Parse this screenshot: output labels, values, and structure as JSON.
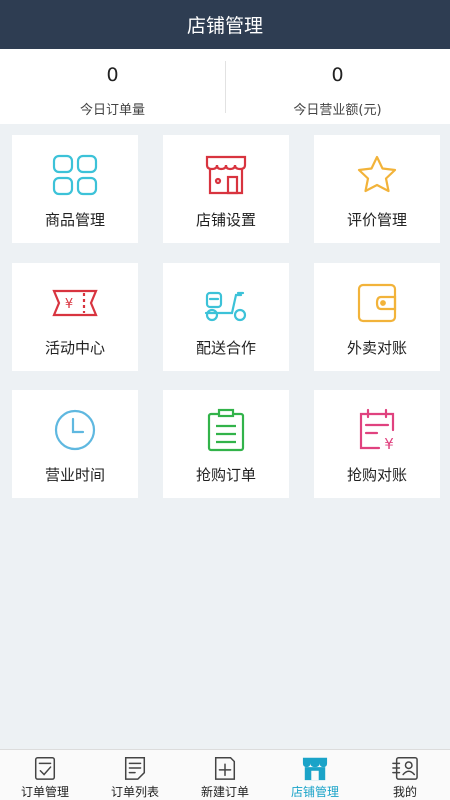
{
  "header": {
    "title": "店铺管理"
  },
  "stats": [
    {
      "value": "0",
      "label": "今日订单量"
    },
    {
      "value": "0",
      "label": "今日营业额(元)"
    }
  ],
  "tiles": [
    {
      "label": "商品管理",
      "icon": "grid-icon"
    },
    {
      "label": "店铺设置",
      "icon": "storefront-icon"
    },
    {
      "label": "评价管理",
      "icon": "star-icon"
    },
    {
      "label": "活动中心",
      "icon": "ticket-icon"
    },
    {
      "label": "配送合作",
      "icon": "scooter-icon"
    },
    {
      "label": "外卖对账",
      "icon": "wallet-icon"
    },
    {
      "label": "营业时间",
      "icon": "clock-icon"
    },
    {
      "label": "抢购订单",
      "icon": "clipboard-icon"
    },
    {
      "label": "抢购对账",
      "icon": "bill-icon"
    }
  ],
  "tabs": [
    {
      "label": "订单管理",
      "icon": "order-manage-icon"
    },
    {
      "label": "订单列表",
      "icon": "order-list-icon"
    },
    {
      "label": "新建订单",
      "icon": "new-order-icon"
    },
    {
      "label": "店铺管理",
      "icon": "shop-icon",
      "active": true
    },
    {
      "label": "我的",
      "icon": "profile-icon"
    }
  ],
  "colors": {
    "header_bg": "#2e3d52",
    "page_bg": "#edf1f4",
    "accent": "#1aa3c8",
    "cyan": "#3cc2d8",
    "red": "#d8343f",
    "yellow": "#f2b33a",
    "green": "#32b34a",
    "pink": "#e0427f",
    "sky": "#5fb8e0"
  }
}
